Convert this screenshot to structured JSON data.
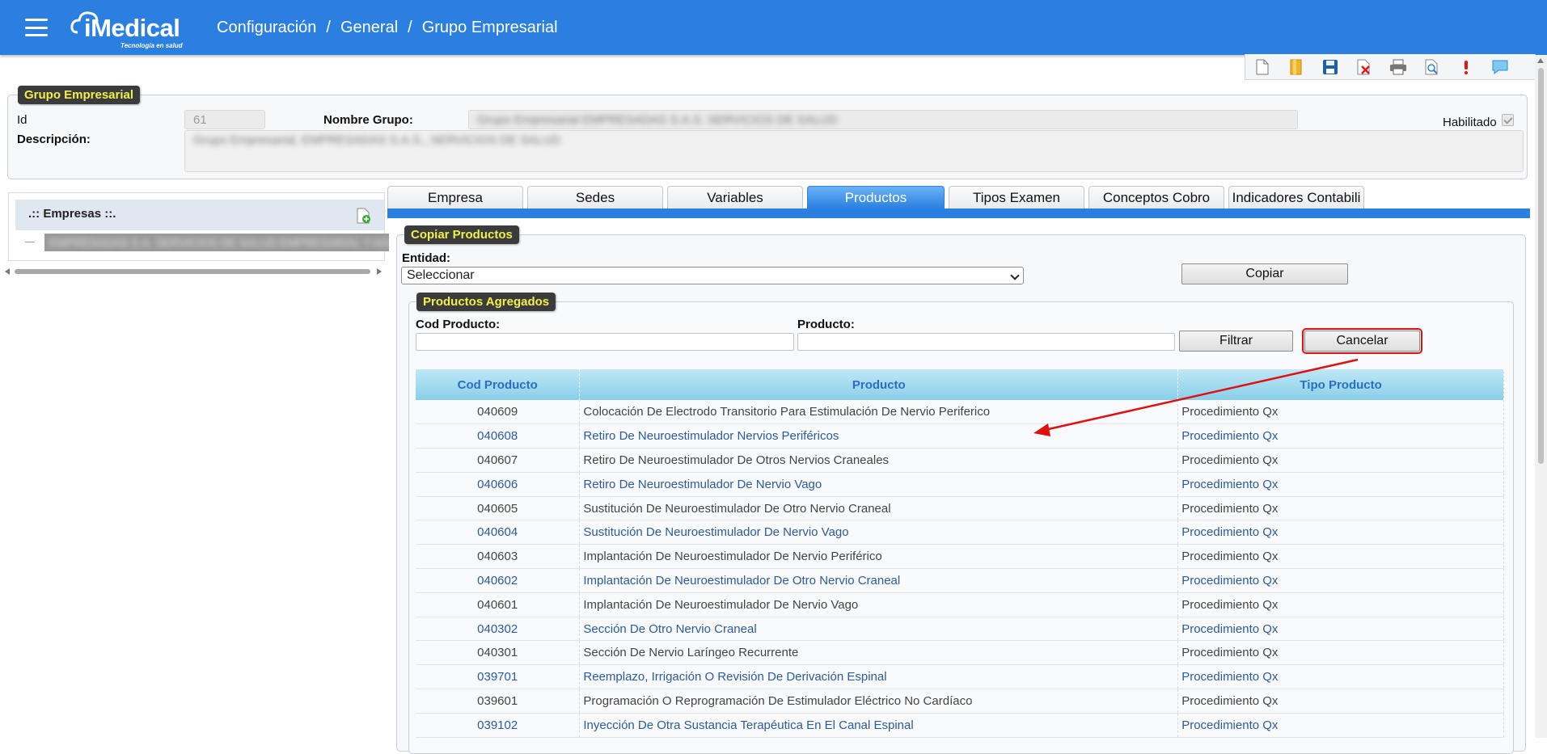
{
  "header": {
    "brand": "iMedical",
    "tagline": "Tecnología en salud",
    "breadcrumb": [
      "Configuración",
      "/",
      "General",
      "/",
      "Grupo Empresarial"
    ]
  },
  "toolbar": {
    "icons": [
      "new-document-icon",
      "open-folder-icon",
      "save-icon",
      "delete-icon",
      "print-icon",
      "preview-icon",
      "alert-icon",
      "comment-icon"
    ]
  },
  "grupo": {
    "legend": "Grupo Empresarial",
    "id_label": "Id",
    "id_value": "61",
    "nombre_label": "Nombre Grupo:",
    "nombre_value": "Grupo Empresarial EMPRESADAS S.A.S. SERVICIOS DE SALUD",
    "descripcion_label": "Descripción:",
    "descripcion_value": "Grupo Empresarial, EMPRESADAS S.A.S., SERVICIOS DE SALUD",
    "habilitado_label": "Habilitado",
    "habilitado_checked": true
  },
  "empresas": {
    "title": ".:: Empresas ::.",
    "item": "EMPRESADAS S.A. SERVICIOS DE SALUD EMPRESARIAL Y ASISTENCIAL"
  },
  "tabs": [
    {
      "label": "Empresa",
      "active": false
    },
    {
      "label": "Sedes",
      "active": false
    },
    {
      "label": "Variables",
      "active": false
    },
    {
      "label": "Productos",
      "active": true
    },
    {
      "label": "Tipos Examen",
      "active": false
    },
    {
      "label": "Conceptos Cobro",
      "active": false
    },
    {
      "label": "Indicadores Contabili",
      "active": false
    }
  ],
  "copiar": {
    "legend": "Copiar Productos",
    "entidad_label": "Entidad:",
    "entidad_selected": "Seleccionar",
    "copiar_button": "Copiar"
  },
  "agregados": {
    "legend": "Productos Agregados",
    "cod_label": "Cod Producto:",
    "producto_label": "Producto:",
    "filtrar_button": "Filtrar",
    "cancelar_button": "Cancelar",
    "columns": [
      "Cod Producto",
      "Producto",
      "Tipo Producto"
    ],
    "rows": [
      [
        "040609",
        "Colocación De Electrodo Transitorio Para Estimulación De Nervio Periferico",
        "Procedimiento Qx"
      ],
      [
        "040608",
        "Retiro De Neuroestimulador Nervios Periféricos",
        "Procedimiento Qx"
      ],
      [
        "040607",
        "Retiro De Neuroestimulador De Otros Nervios Craneales",
        "Procedimiento Qx"
      ],
      [
        "040606",
        "Retiro De Neuroestimulador De Nervio Vago",
        "Procedimiento Qx"
      ],
      [
        "040605",
        "Sustitución De Neuroestimulador De Otro Nervio Craneal",
        "Procedimiento Qx"
      ],
      [
        "040604",
        "Sustitución De Neuroestimulador De Nervio Vago",
        "Procedimiento Qx"
      ],
      [
        "040603",
        "Implantación De Neuroestimulador De Nervio Periférico",
        "Procedimiento Qx"
      ],
      [
        "040602",
        "Implantación De Neuroestimulador De Otro Nervio Craneal",
        "Procedimiento Qx"
      ],
      [
        "040601",
        "Implantación De Neuroestimulador De Nervio Vago",
        "Procedimiento Qx"
      ],
      [
        "040302",
        "Sección De Otro Nervio Craneal",
        "Procedimiento Qx"
      ],
      [
        "040301",
        "Sección De Nervio Laríngeo Recurrente",
        "Procedimiento Qx"
      ],
      [
        "039701",
        "Reemplazo, Irrigación O Revisión De Derivación Espinal",
        "Procedimiento Qx"
      ],
      [
        "039601",
        "Programación O Reprogramación De Estimulador Eléctrico No Cardíaco",
        "Procedimiento Qx"
      ],
      [
        "039102",
        "Inyección De Otra Sustancia Terapéutica En El Canal Espinal",
        "Procedimiento Qx"
      ]
    ]
  },
  "colors": {
    "primary": "#2a7fe0",
    "legend_bg": "#3b3b3b",
    "legend_text": "#f1f04a",
    "annotation": "#e01010"
  }
}
